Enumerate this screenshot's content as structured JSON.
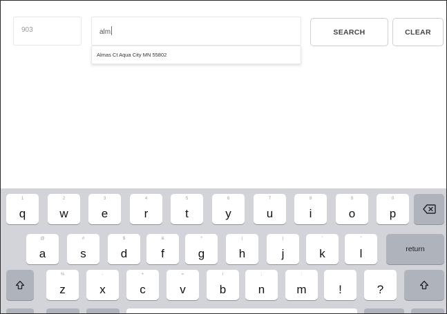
{
  "form": {
    "house_number": "903",
    "street_value": "alm",
    "search_label": "SEARCH",
    "clear_label": "CLEAR",
    "suggestion": "Almas Ct Aqua City MN 55802"
  },
  "keyboard": {
    "row1": [
      {
        "main": "q",
        "hint": "1"
      },
      {
        "main": "w",
        "hint": "2"
      },
      {
        "main": "e",
        "hint": "3"
      },
      {
        "main": "r",
        "hint": "4"
      },
      {
        "main": "t",
        "hint": "5"
      },
      {
        "main": "y",
        "hint": "6"
      },
      {
        "main": "u",
        "hint": "7"
      },
      {
        "main": "i",
        "hint": "8"
      },
      {
        "main": "o",
        "hint": "9"
      },
      {
        "main": "p",
        "hint": "0"
      }
    ],
    "row2": [
      {
        "main": "a",
        "hint": "@"
      },
      {
        "main": "s",
        "hint": "#"
      },
      {
        "main": "d",
        "hint": "$"
      },
      {
        "main": "f",
        "hint": "&"
      },
      {
        "main": "g",
        "hint": "*"
      },
      {
        "main": "h",
        "hint": "("
      },
      {
        "main": "j",
        "hint": ")"
      },
      {
        "main": "k",
        "hint": "'"
      },
      {
        "main": "l",
        "hint": "\""
      }
    ],
    "row3": [
      {
        "main": "z",
        "hint": "%"
      },
      {
        "main": "x",
        "hint": "-"
      },
      {
        "main": "c",
        "hint": "+"
      },
      {
        "main": "v",
        "hint": "="
      },
      {
        "main": "b",
        "hint": "/"
      },
      {
        "main": "n",
        "hint": ";"
      },
      {
        "main": "m",
        "hint": ":"
      },
      {
        "main": "!",
        "hint": ""
      },
      {
        "main": "?",
        "hint": ""
      }
    ],
    "return_label": "return",
    "backspace_icon": "backspace-icon",
    "shift_icon": "shift-icon"
  }
}
